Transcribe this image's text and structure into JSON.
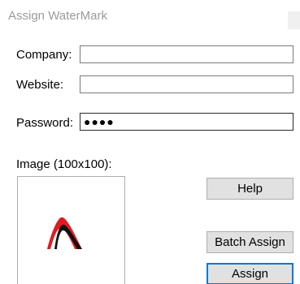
{
  "window": {
    "title": "Assign WaterMark"
  },
  "form": {
    "company_label": "Company:",
    "company_value": "",
    "website_label": "Website:",
    "website_value": "",
    "password_label": "Password:",
    "password_masked": "●●●●",
    "image_label": "Image (100x100):"
  },
  "buttons": {
    "help": "Help",
    "batch_assign": "Batch Assign",
    "assign": "Assign"
  },
  "colors": {
    "logo_red": "#e11b22",
    "logo_black": "#111111",
    "default_button_border": "#0078d7",
    "button_face": "#e1e1e1"
  },
  "icons": {
    "logo": "watermark-logo-icon",
    "close": "close-icon"
  }
}
